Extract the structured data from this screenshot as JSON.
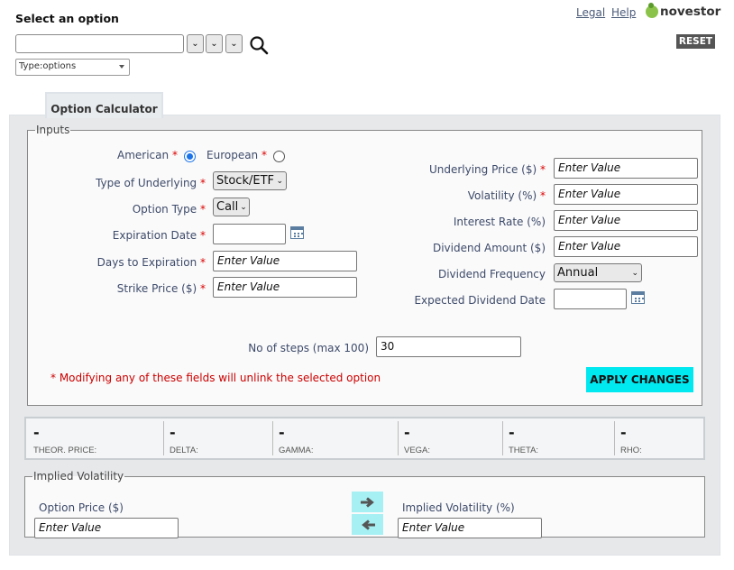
{
  "header": {
    "select_title": "Select an option",
    "type_select": "Type:options",
    "links": {
      "legal": "Legal",
      "help": "Help"
    },
    "logo": "novestor",
    "reset": "RESET"
  },
  "tab": {
    "label": "Option Calculator"
  },
  "inputs": {
    "legend": "Inputs",
    "style": {
      "american": "American",
      "european": "European",
      "selected": "american"
    },
    "type_of_underlying": {
      "label": "Type of Underlying",
      "value": "Stock/ETF"
    },
    "option_type": {
      "label": "Option Type",
      "value": "Call"
    },
    "expiration_date": {
      "label": "Expiration Date",
      "value": ""
    },
    "days_to_expiration": {
      "label": "Days to Expiration",
      "placeholder": "Enter Value"
    },
    "strike_price": {
      "label": "Strike Price ($)",
      "placeholder": "Enter Value"
    },
    "underlying_price": {
      "label": "Underlying Price ($)",
      "placeholder": "Enter Value"
    },
    "volatility": {
      "label": "Volatility (%)",
      "placeholder": "Enter Value"
    },
    "interest_rate": {
      "label": "Interest Rate (%)",
      "placeholder": "Enter Value"
    },
    "dividend_amount": {
      "label": "Dividend Amount ($)",
      "placeholder": "Enter Value"
    },
    "dividend_frequency": {
      "label": "Dividend Frequency",
      "value": "Annual"
    },
    "expected_dividend_date": {
      "label": "Expected Dividend Date",
      "value": ""
    },
    "steps": {
      "label": "No of steps (max 100)",
      "value": "30"
    },
    "required_mark": "*",
    "warning": "* Modifying any of these fields will unlink the selected option",
    "apply": "APPLY CHANGES"
  },
  "results": [
    {
      "name": "THEOR. PRICE:",
      "value": "-"
    },
    {
      "name": "DELTA:",
      "value": "-"
    },
    {
      "name": "GAMMA:",
      "value": "-"
    },
    {
      "name": "VEGA:",
      "value": "-"
    },
    {
      "name": "THETA:",
      "value": "-"
    },
    {
      "name": "RHO:",
      "value": "-"
    }
  ],
  "implied_volatility": {
    "legend": "Implied Volatility",
    "option_price": {
      "label": "Option Price ($)",
      "placeholder": "Enter Value"
    },
    "iv": {
      "label": "Implied Volatility (%)",
      "placeholder": "Enter Value"
    }
  },
  "colors": {
    "apply_bg": "#00e8f0",
    "arrow_bg": "#a6f0f4",
    "required": "#d00000",
    "reset_bg": "#555555"
  }
}
